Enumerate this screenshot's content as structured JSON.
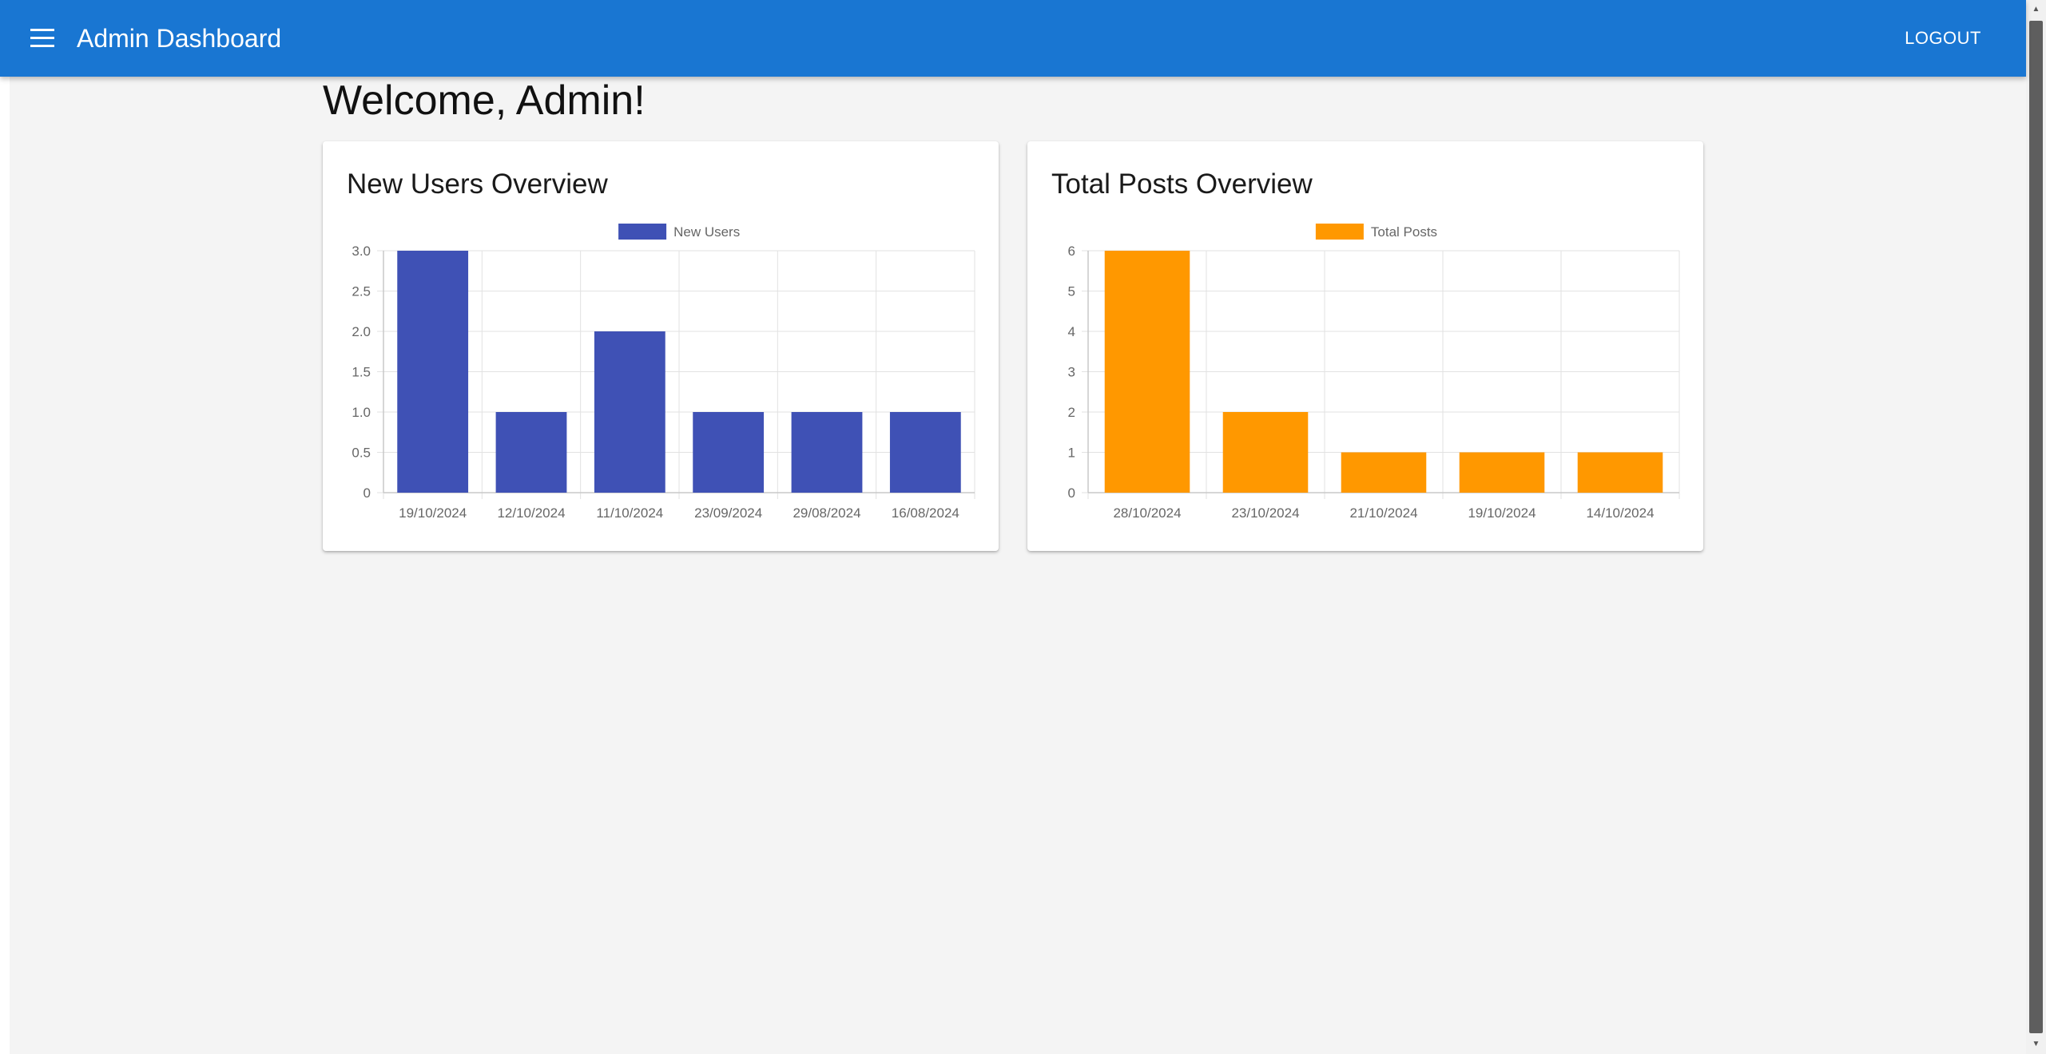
{
  "appbar": {
    "title": "Admin Dashboard",
    "logout_label": "LOGOUT",
    "menu_icon": "hamburger-menu-icon",
    "color": "#1976d2"
  },
  "page": {
    "welcome": "Welcome, Admin!"
  },
  "cards": {
    "users": {
      "title": "New Users Overview"
    },
    "posts": {
      "title": "Total Posts Overview"
    }
  },
  "chart_data": [
    {
      "type": "bar",
      "categories": [
        "19/10/2024",
        "12/10/2024",
        "11/10/2024",
        "23/09/2024",
        "29/08/2024",
        "16/08/2024"
      ],
      "series": [
        {
          "name": "New Users",
          "values": [
            3,
            1,
            2,
            1,
            1,
            1
          ]
        }
      ],
      "color": "#3f51b5",
      "ylim": [
        0,
        3
      ],
      "yticks": [
        "0",
        "0.5",
        "1.0",
        "1.5",
        "2.0",
        "2.5",
        "3.0"
      ],
      "grid": true,
      "legend": "top-center"
    },
    {
      "type": "bar",
      "categories": [
        "28/10/2024",
        "23/10/2024",
        "21/10/2024",
        "19/10/2024",
        "14/10/2024"
      ],
      "series": [
        {
          "name": "Total Posts",
          "values": [
            6,
            2,
            1,
            1,
            1
          ]
        }
      ],
      "color": "#ff9800",
      "ylim": [
        0,
        6
      ],
      "yticks": [
        "0",
        "1",
        "2",
        "3",
        "4",
        "5",
        "6"
      ],
      "grid": true,
      "legend": "top-center"
    }
  ]
}
